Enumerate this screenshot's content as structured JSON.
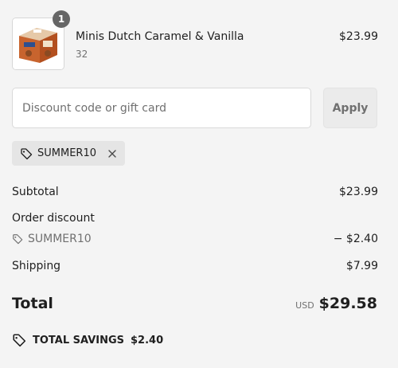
{
  "line_item": {
    "quantity": "1",
    "name": "Minis Dutch Caramel & Vanilla",
    "variant": "32",
    "price": "$23.99"
  },
  "discount_form": {
    "placeholder": "Discount code or gift card",
    "apply_label": "Apply"
  },
  "applied_tag": {
    "code": "SUMMER10"
  },
  "summary": {
    "subtotal_label": "Subtotal",
    "subtotal_value": "$23.99",
    "order_discount_label": "Order discount",
    "discount_code": "SUMMER10",
    "discount_value": "− $2.40",
    "shipping_label": "Shipping",
    "shipping_value": "$7.99"
  },
  "total": {
    "label": "Total",
    "currency": "USD",
    "amount": "$29.58"
  },
  "savings": {
    "label": "TOTAL SAVINGS",
    "amount": "$2.40"
  },
  "icons": {
    "tag": "tag-icon",
    "remove": "close-icon"
  }
}
